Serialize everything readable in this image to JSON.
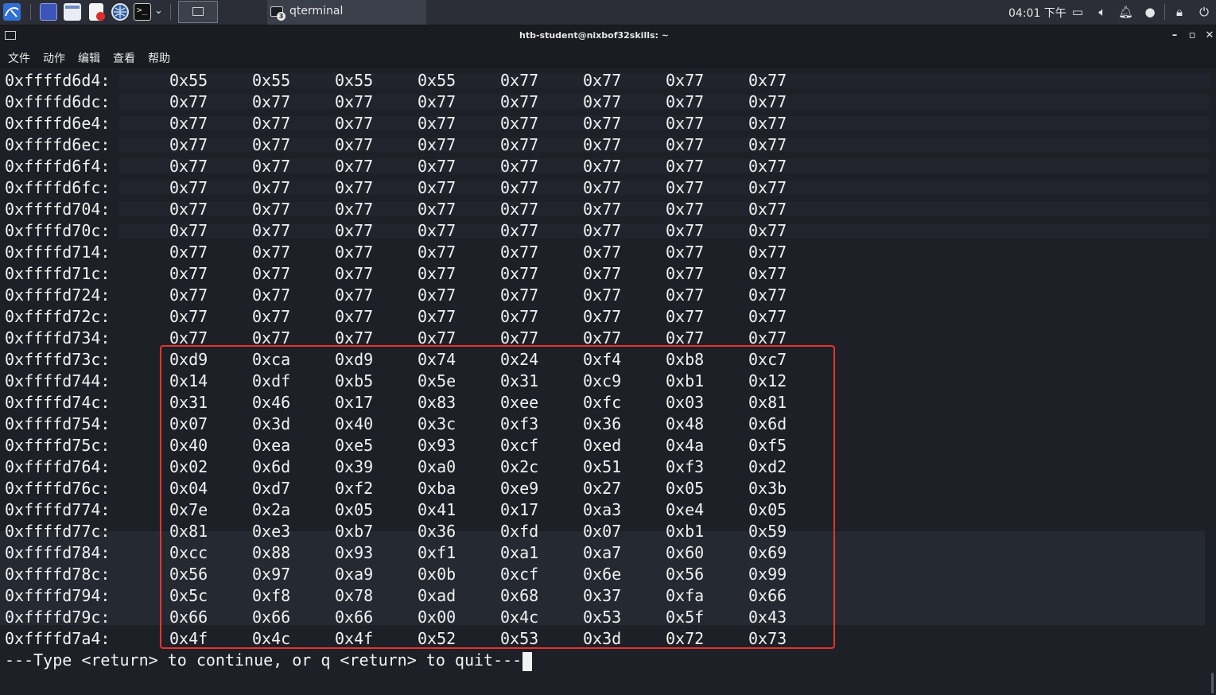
{
  "taskbar": {
    "active_window_title": "qterminal",
    "badge_count": "3",
    "clock": "04:01 下午"
  },
  "window": {
    "title": "htb-student@nixbof32skills: ~",
    "minimize": "–",
    "maximize": "▫",
    "close": "✕"
  },
  "menubar": {
    "items": [
      "文件",
      "动作",
      "编辑",
      "查看",
      "帮助"
    ]
  },
  "terminal": {
    "rows": [
      {
        "addr": "0xffffd6d4:",
        "bytes": [
          "0x55",
          "0x55",
          "0x55",
          "0x55",
          "0x77",
          "0x77",
          "0x77",
          "0x77"
        ]
      },
      {
        "addr": "0xffffd6dc:",
        "bytes": [
          "0x77",
          "0x77",
          "0x77",
          "0x77",
          "0x77",
          "0x77",
          "0x77",
          "0x77"
        ]
      },
      {
        "addr": "0xffffd6e4:",
        "bytes": [
          "0x77",
          "0x77",
          "0x77",
          "0x77",
          "0x77",
          "0x77",
          "0x77",
          "0x77"
        ]
      },
      {
        "addr": "0xffffd6ec:",
        "bytes": [
          "0x77",
          "0x77",
          "0x77",
          "0x77",
          "0x77",
          "0x77",
          "0x77",
          "0x77"
        ]
      },
      {
        "addr": "0xffffd6f4:",
        "bytes": [
          "0x77",
          "0x77",
          "0x77",
          "0x77",
          "0x77",
          "0x77",
          "0x77",
          "0x77"
        ]
      },
      {
        "addr": "0xffffd6fc:",
        "bytes": [
          "0x77",
          "0x77",
          "0x77",
          "0x77",
          "0x77",
          "0x77",
          "0x77",
          "0x77"
        ]
      },
      {
        "addr": "0xffffd704:",
        "bytes": [
          "0x77",
          "0x77",
          "0x77",
          "0x77",
          "0x77",
          "0x77",
          "0x77",
          "0x77"
        ]
      },
      {
        "addr": "0xffffd70c:",
        "bytes": [
          "0x77",
          "0x77",
          "0x77",
          "0x77",
          "0x77",
          "0x77",
          "0x77",
          "0x77"
        ]
      },
      {
        "addr": "0xffffd714:",
        "bytes": [
          "0x77",
          "0x77",
          "0x77",
          "0x77",
          "0x77",
          "0x77",
          "0x77",
          "0x77"
        ]
      },
      {
        "addr": "0xffffd71c:",
        "bytes": [
          "0x77",
          "0x77",
          "0x77",
          "0x77",
          "0x77",
          "0x77",
          "0x77",
          "0x77"
        ]
      },
      {
        "addr": "0xffffd724:",
        "bytes": [
          "0x77",
          "0x77",
          "0x77",
          "0x77",
          "0x77",
          "0x77",
          "0x77",
          "0x77"
        ]
      },
      {
        "addr": "0xffffd72c:",
        "bytes": [
          "0x77",
          "0x77",
          "0x77",
          "0x77",
          "0x77",
          "0x77",
          "0x77",
          "0x77"
        ]
      },
      {
        "addr": "0xffffd734:",
        "bytes": [
          "0x77",
          "0x77",
          "0x77",
          "0x77",
          "0x77",
          "0x77",
          "0x77",
          "0x77"
        ]
      },
      {
        "addr": "0xffffd73c:",
        "bytes": [
          "0xd9",
          "0xca",
          "0xd9",
          "0x74",
          "0x24",
          "0xf4",
          "0xb8",
          "0xc7"
        ]
      },
      {
        "addr": "0xffffd744:",
        "bytes": [
          "0x14",
          "0xdf",
          "0xb5",
          "0x5e",
          "0x31",
          "0xc9",
          "0xb1",
          "0x12"
        ]
      },
      {
        "addr": "0xffffd74c:",
        "bytes": [
          "0x31",
          "0x46",
          "0x17",
          "0x83",
          "0xee",
          "0xfc",
          "0x03",
          "0x81"
        ]
      },
      {
        "addr": "0xffffd754:",
        "bytes": [
          "0x07",
          "0x3d",
          "0x40",
          "0x3c",
          "0xf3",
          "0x36",
          "0x48",
          "0x6d"
        ]
      },
      {
        "addr": "0xffffd75c:",
        "bytes": [
          "0x40",
          "0xea",
          "0xe5",
          "0x93",
          "0xcf",
          "0xed",
          "0x4a",
          "0xf5"
        ]
      },
      {
        "addr": "0xffffd764:",
        "bytes": [
          "0x02",
          "0x6d",
          "0x39",
          "0xa0",
          "0x2c",
          "0x51",
          "0xf3",
          "0xd2"
        ]
      },
      {
        "addr": "0xffffd76c:",
        "bytes": [
          "0x04",
          "0xd7",
          "0xf2",
          "0xba",
          "0xe9",
          "0x27",
          "0x05",
          "0x3b"
        ]
      },
      {
        "addr": "0xffffd774:",
        "bytes": [
          "0x7e",
          "0x2a",
          "0x05",
          "0x41",
          "0x17",
          "0xa3",
          "0xe4",
          "0x05"
        ]
      },
      {
        "addr": "0xffffd77c:",
        "bytes": [
          "0x81",
          "0xe3",
          "0xb7",
          "0x36",
          "0xfd",
          "0x07",
          "0xb1",
          "0x59"
        ]
      },
      {
        "addr": "0xffffd784:",
        "bytes": [
          "0xcc",
          "0x88",
          "0x93",
          "0xf1",
          "0xa1",
          "0xa7",
          "0x60",
          "0x69"
        ]
      },
      {
        "addr": "0xffffd78c:",
        "bytes": [
          "0x56",
          "0x97",
          "0xa9",
          "0x0b",
          "0xcf",
          "0x6e",
          "0x56",
          "0x99"
        ]
      },
      {
        "addr": "0xffffd794:",
        "bytes": [
          "0x5c",
          "0xf8",
          "0x78",
          "0xad",
          "0x68",
          "0x37",
          "0xfa",
          "0x66"
        ]
      },
      {
        "addr": "0xffffd79c:",
        "bytes": [
          "0x66",
          "0x66",
          "0x66",
          "0x00",
          "0x4c",
          "0x53",
          "0x5f",
          "0x43"
        ]
      },
      {
        "addr": "0xffffd7a4:",
        "bytes": [
          "0x4f",
          "0x4c",
          "0x4f",
          "0x52",
          "0x53",
          "0x3d",
          "0x72",
          "0x73"
        ]
      }
    ],
    "prompt": "---Type <return> to continue, or q <return> to quit---"
  },
  "colors": {
    "terminal_bg": "#1d2027",
    "text": "#f2f2f2",
    "highlight_border": "#e8332c",
    "panel_bg": "#2b2e37"
  }
}
